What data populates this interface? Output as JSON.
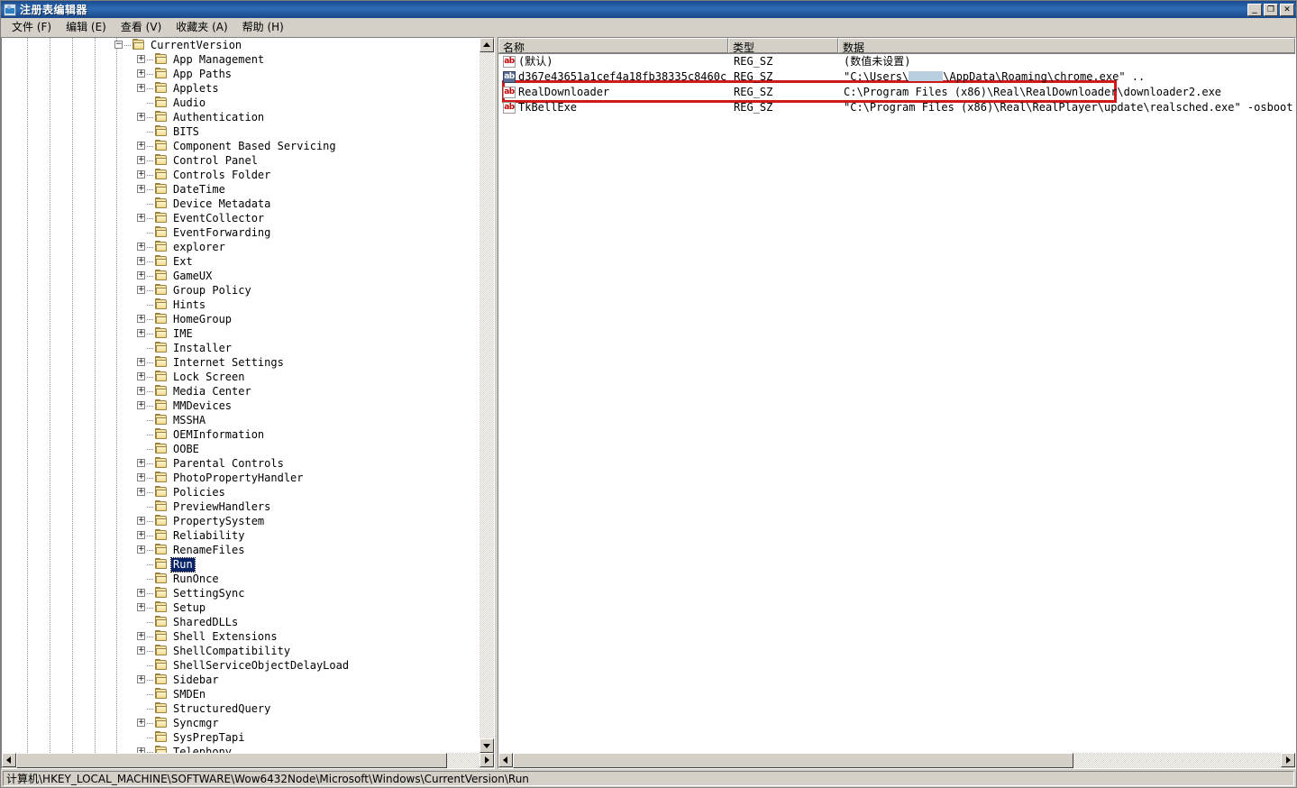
{
  "window": {
    "title": "注册表编辑器",
    "icon": "registry-editor-icon",
    "minimize_label": "_",
    "maximize_label": "❐",
    "close_label": "✕"
  },
  "menu": [
    {
      "label": "文件 (F)",
      "name": "menu-file"
    },
    {
      "label": "编辑 (E)",
      "name": "menu-edit"
    },
    {
      "label": "查看 (V)",
      "name": "menu-view"
    },
    {
      "label": "收藏夹 (A)",
      "name": "menu-favorites"
    },
    {
      "label": "帮助 (H)",
      "name": "menu-help"
    }
  ],
  "tree": {
    "nodes": [
      {
        "label": "CurrentVersion",
        "depth": 5,
        "expander": "minus",
        "selected": false
      },
      {
        "label": "App Management",
        "depth": 6,
        "expander": "plus",
        "selected": false
      },
      {
        "label": "App Paths",
        "depth": 6,
        "expander": "plus",
        "selected": false
      },
      {
        "label": "Applets",
        "depth": 6,
        "expander": "plus",
        "selected": false
      },
      {
        "label": "Audio",
        "depth": 6,
        "expander": "none",
        "selected": false
      },
      {
        "label": "Authentication",
        "depth": 6,
        "expander": "plus",
        "selected": false
      },
      {
        "label": "BITS",
        "depth": 6,
        "expander": "none",
        "selected": false
      },
      {
        "label": "Component Based Servicing",
        "depth": 6,
        "expander": "plus",
        "selected": false
      },
      {
        "label": "Control Panel",
        "depth": 6,
        "expander": "plus",
        "selected": false
      },
      {
        "label": "Controls Folder",
        "depth": 6,
        "expander": "plus",
        "selected": false
      },
      {
        "label": "DateTime",
        "depth": 6,
        "expander": "plus",
        "selected": false
      },
      {
        "label": "Device Metadata",
        "depth": 6,
        "expander": "none",
        "selected": false
      },
      {
        "label": "EventCollector",
        "depth": 6,
        "expander": "plus",
        "selected": false
      },
      {
        "label": "EventForwarding",
        "depth": 6,
        "expander": "none",
        "selected": false
      },
      {
        "label": "explorer",
        "depth": 6,
        "expander": "plus",
        "selected": false
      },
      {
        "label": "Ext",
        "depth": 6,
        "expander": "plus",
        "selected": false
      },
      {
        "label": "GameUX",
        "depth": 6,
        "expander": "plus",
        "selected": false
      },
      {
        "label": "Group Policy",
        "depth": 6,
        "expander": "plus",
        "selected": false
      },
      {
        "label": "Hints",
        "depth": 6,
        "expander": "none",
        "selected": false
      },
      {
        "label": "HomeGroup",
        "depth": 6,
        "expander": "plus",
        "selected": false
      },
      {
        "label": "IME",
        "depth": 6,
        "expander": "plus",
        "selected": false
      },
      {
        "label": "Installer",
        "depth": 6,
        "expander": "none",
        "selected": false
      },
      {
        "label": "Internet Settings",
        "depth": 6,
        "expander": "plus",
        "selected": false
      },
      {
        "label": "Lock Screen",
        "depth": 6,
        "expander": "plus",
        "selected": false
      },
      {
        "label": "Media Center",
        "depth": 6,
        "expander": "plus",
        "selected": false
      },
      {
        "label": "MMDevices",
        "depth": 6,
        "expander": "plus",
        "selected": false
      },
      {
        "label": "MSSHA",
        "depth": 6,
        "expander": "none",
        "selected": false
      },
      {
        "label": "OEMInformation",
        "depth": 6,
        "expander": "none",
        "selected": false
      },
      {
        "label": "OOBE",
        "depth": 6,
        "expander": "none",
        "selected": false
      },
      {
        "label": "Parental Controls",
        "depth": 6,
        "expander": "plus",
        "selected": false
      },
      {
        "label": "PhotoPropertyHandler",
        "depth": 6,
        "expander": "plus",
        "selected": false
      },
      {
        "label": "Policies",
        "depth": 6,
        "expander": "plus",
        "selected": false
      },
      {
        "label": "PreviewHandlers",
        "depth": 6,
        "expander": "none",
        "selected": false
      },
      {
        "label": "PropertySystem",
        "depth": 6,
        "expander": "plus",
        "selected": false
      },
      {
        "label": "Reliability",
        "depth": 6,
        "expander": "plus",
        "selected": false
      },
      {
        "label": "RenameFiles",
        "depth": 6,
        "expander": "plus",
        "selected": false
      },
      {
        "label": "Run",
        "depth": 6,
        "expander": "none",
        "selected": true
      },
      {
        "label": "RunOnce",
        "depth": 6,
        "expander": "none",
        "selected": false
      },
      {
        "label": "SettingSync",
        "depth": 6,
        "expander": "plus",
        "selected": false
      },
      {
        "label": "Setup",
        "depth": 6,
        "expander": "plus",
        "selected": false
      },
      {
        "label": "SharedDLLs",
        "depth": 6,
        "expander": "none",
        "selected": false
      },
      {
        "label": "Shell Extensions",
        "depth": 6,
        "expander": "plus",
        "selected": false
      },
      {
        "label": "ShellCompatibility",
        "depth": 6,
        "expander": "plus",
        "selected": false
      },
      {
        "label": "ShellServiceObjectDelayLoad",
        "depth": 6,
        "expander": "none",
        "selected": false
      },
      {
        "label": "Sidebar",
        "depth": 6,
        "expander": "plus",
        "selected": false
      },
      {
        "label": "SMDEn",
        "depth": 6,
        "expander": "none",
        "selected": false
      },
      {
        "label": "StructuredQuery",
        "depth": 6,
        "expander": "none",
        "selected": false
      },
      {
        "label": "Syncmgr",
        "depth": 6,
        "expander": "plus",
        "selected": false
      },
      {
        "label": "SysPrepTapi",
        "depth": 6,
        "expander": "none",
        "selected": false
      },
      {
        "label": "Telephony",
        "depth": 6,
        "expander": "plus",
        "selected": false
      }
    ]
  },
  "values": {
    "columns": [
      {
        "label": "名称",
        "name": "column-name"
      },
      {
        "label": "类型",
        "name": "column-type"
      },
      {
        "label": "数据",
        "name": "column-data"
      }
    ],
    "rows": [
      {
        "name": "(默认)",
        "type": "REG_SZ",
        "data": "(数值未设置)",
        "icon": "string-value-icon",
        "selected": false,
        "highlighted": false,
        "redacted": false
      },
      {
        "name": "d367e43651a1cef4a18fb38335c8460c",
        "type": "REG_SZ",
        "data_prefix": "\"C:\\Users\\",
        "data_suffix": "\\AppData\\Roaming\\chrome.exe\" ..",
        "data": "\"C:\\Users\\[redacted]\\AppData\\Roaming\\chrome.exe\" ..",
        "icon": "string-value-icon",
        "selected": true,
        "highlighted": true,
        "redacted": true
      },
      {
        "name": "RealDownloader",
        "type": "REG_SZ",
        "data": "C:\\Program Files (x86)\\Real\\RealDownloader\\downloader2.exe",
        "icon": "string-value-icon",
        "selected": false,
        "highlighted": false,
        "redacted": false
      },
      {
        "name": "TkBellExe",
        "type": "REG_SZ",
        "data": "\"C:\\Program Files (x86)\\Real\\RealPlayer\\update\\realsched.exe\"  -osboot",
        "icon": "string-value-icon",
        "selected": false,
        "highlighted": false,
        "redacted": false
      }
    ]
  },
  "statusbar": {
    "path": "计算机\\HKEY_LOCAL_MACHINE\\SOFTWARE\\Wow6432Node\\Microsoft\\Windows\\CurrentVersion\\Run"
  },
  "colors": {
    "title_bar": "#1a4b8c",
    "chrome": "#d4d0c8",
    "selection": "#0a246a",
    "annotation": "#d01919",
    "icon_text": "#c00000"
  }
}
